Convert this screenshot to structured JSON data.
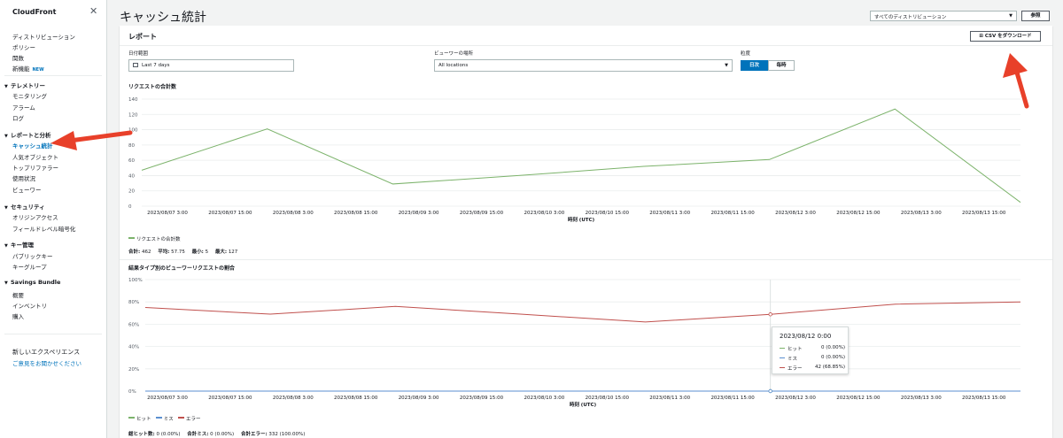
{
  "sidebar": {
    "title": "CloudFront",
    "close": "✕",
    "top_links": [
      "ディストリビューション",
      "ポリシー",
      "関数",
      "新機能"
    ],
    "new_badge": "NEW",
    "sections": [
      {
        "title": "テレメトリー",
        "items": [
          "モニタリング",
          "アラーム",
          "ログ"
        ]
      },
      {
        "title": "レポートと分析",
        "items": [
          "キャッシュ統計",
          "人気オブジェクト",
          "トップリファラー",
          "使用状況",
          "ビューワー"
        ]
      },
      {
        "title": "セキュリティ",
        "items": [
          "オリジンアクセス",
          "フィールドレベル暗号化"
        ]
      },
      {
        "title": "キー管理",
        "items": [
          "パブリックキー",
          "キーグループ"
        ]
      },
      {
        "title": "Savings Bundle",
        "items": [
          "概要",
          "インベントリ",
          "購入"
        ]
      }
    ],
    "active_item": "キャッシュ統計",
    "experience_title": "新しいエクスペリエンス",
    "feedback_link": "ご意見をお聞かせください"
  },
  "header": {
    "title": "キャッシュ統計",
    "distribution_select": "すべてのディストリビューション",
    "reference_button": "参照"
  },
  "report": {
    "title": "レポート",
    "csv_button": "CSV をダウンロード",
    "date_label": "日付範囲",
    "date_value": "Last 7 days",
    "location_label": "ビューワーの場所",
    "location_value": "All locations",
    "granularity_label": "粒度",
    "granularity_options": [
      "日次",
      "毎時"
    ],
    "granularity_selected": "日次"
  },
  "requests_chart": {
    "title": "リクエストの合計数",
    "legend": "リクエストの合計数",
    "stats": {
      "total_label": "合計:",
      "total": "462",
      "avg_label": "平均:",
      "avg": "57.75",
      "min_label": "最小:",
      "min": "5",
      "max_label": "最大:",
      "max": "127"
    }
  },
  "ratio_chart": {
    "title": "結果タイプ別のビューワーリクエストの割合",
    "legend": [
      "ヒット",
      "ミス",
      "エラー"
    ],
    "stats": {
      "hit_label": "総ヒット数:",
      "hit": "0 (0.00%)",
      "miss_label": "合計ミス:",
      "miss": "0 (0.00%)",
      "error_label": "合計エラー:",
      "error": "332 (100.00%)"
    },
    "tooltip": {
      "title": "2023/08/12 0:00",
      "rows": [
        {
          "label": "ヒット",
          "value": "0 (0.00%)"
        },
        {
          "label": "ミス",
          "value": "0 (0.00%)"
        },
        {
          "label": "エラー",
          "value": "42 (68.85%)"
        }
      ]
    }
  },
  "colors": {
    "accent": "#0073bb",
    "requests": "#7cb36b",
    "hit": "#7cb36b",
    "miss": "#5b8fd0",
    "error": "#c0504d",
    "arrow": "#e8402a"
  },
  "chart_data": [
    {
      "type": "line",
      "title": "リクエストの合計数",
      "xlabel": "時刻 (UTC)",
      "ylabel": "",
      "ylim": [
        0,
        140
      ],
      "yticks": [
        0,
        20,
        40,
        60,
        80,
        100,
        120,
        140
      ],
      "xticks": [
        "2023/08/07 3:00",
        "2023/08/07 15:00",
        "2023/08/08 3:00",
        "2023/08/08 15:00",
        "2023/08/09 3:00",
        "2023/08/09 15:00",
        "2023/08/10 3:00",
        "2023/08/10 15:00",
        "2023/08/11 3:00",
        "2023/08/11 15:00",
        "2023/08/12 3:00",
        "2023/08/12 15:00",
        "2023/08/13 3:00",
        "2023/08/13 15:00"
      ],
      "x": [
        "2023/08/07 0:00",
        "2023/08/08 0:00",
        "2023/08/09 0:00",
        "2023/08/10 0:00",
        "2023/08/11 0:00",
        "2023/08/12 0:00",
        "2023/08/13 0:00",
        "2023/08/14 0:00"
      ],
      "series": [
        {
          "name": "リクエストの合計数",
          "values": [
            47,
            101,
            29,
            40,
            52,
            61,
            127,
            5
          ]
        }
      ],
      "grid": true,
      "legend": "bottom-left"
    },
    {
      "type": "line",
      "title": "結果タイプ別のビューワーリクエストの割合",
      "xlabel": "時刻 (UTC)",
      "ylabel": "",
      "ylim": [
        0,
        100
      ],
      "yticks": [
        "0%",
        "20%",
        "40%",
        "60%",
        "80%",
        "100%"
      ],
      "xticks": [
        "2023/08/07 3:00",
        "2023/08/07 15:00",
        "2023/08/08 3:00",
        "2023/08/08 15:00",
        "2023/08/09 3:00",
        "2023/08/09 15:00",
        "2023/08/10 3:00",
        "2023/08/10 15:00",
        "2023/08/11 3:00",
        "2023/08/11 15:00",
        "2023/08/12 3:00",
        "2023/08/12 15:00",
        "2023/08/13 3:00",
        "2023/08/13 15:00"
      ],
      "x": [
        "2023/08/07 0:00",
        "2023/08/08 0:00",
        "2023/08/09 0:00",
        "2023/08/10 0:00",
        "2023/08/11 0:00",
        "2023/08/12 0:00",
        "2023/08/13 0:00",
        "2023/08/14 0:00"
      ],
      "series": [
        {
          "name": "ヒット",
          "values": [
            0,
            0,
            0,
            0,
            0,
            0,
            0,
            0
          ]
        },
        {
          "name": "ミス",
          "values": [
            0,
            0,
            0,
            0,
            0,
            0,
            0,
            0
          ]
        },
        {
          "name": "エラー",
          "values": [
            75,
            69,
            76,
            69,
            62,
            68.85,
            78,
            80
          ]
        }
      ],
      "grid": true,
      "legend": "bottom-left"
    }
  ]
}
